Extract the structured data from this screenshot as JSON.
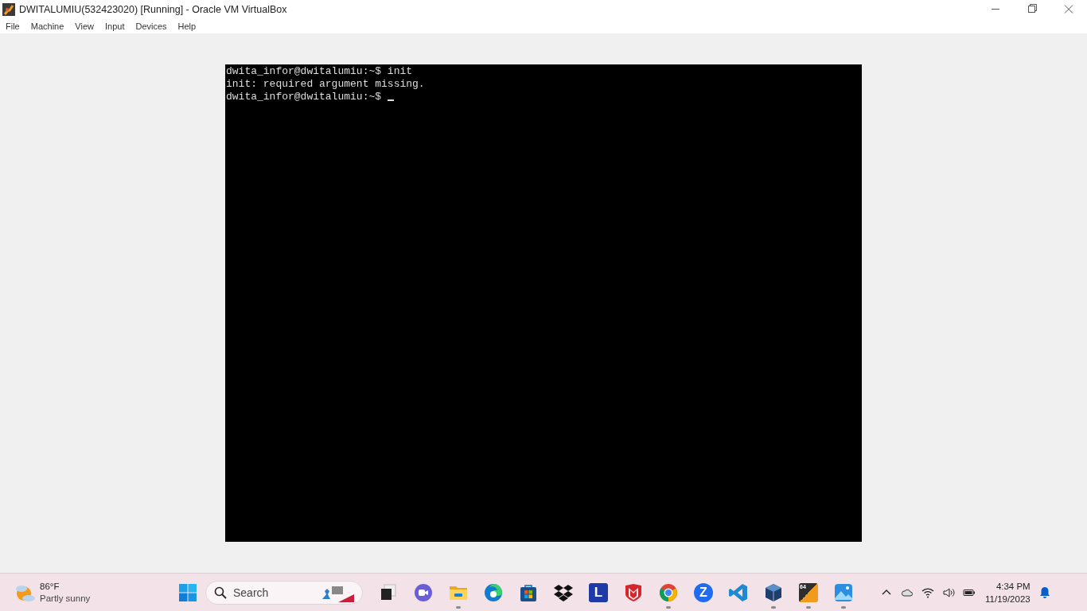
{
  "window": {
    "title": "DWITALUMIU(532423020) [Running] - Oracle VM VirtualBox"
  },
  "menu": [
    "File",
    "Machine",
    "View",
    "Input",
    "Devices",
    "Help"
  ],
  "terminal": {
    "lines": [
      "dwita_infor@dwitalumiu:~$ init",
      "init: required argument missing.",
      "dwita_infor@dwitalumiu:~$ "
    ],
    "cursor_visible": true
  },
  "taskbar": {
    "weather": {
      "temperature": "86°F",
      "condition": "Partly sunny"
    },
    "search": {
      "placeholder": "Search"
    },
    "apps": [
      {
        "kind": "windows-start",
        "running": false
      },
      {
        "kind": "task-view",
        "running": false
      },
      {
        "kind": "chat",
        "running": false
      },
      {
        "kind": "folder",
        "running": true
      },
      {
        "kind": "edge",
        "running": false
      },
      {
        "kind": "store",
        "running": false
      },
      {
        "kind": "dropbox",
        "running": false
      },
      {
        "kind": "letter",
        "glyph": "L",
        "running": false
      },
      {
        "kind": "shield",
        "running": false
      },
      {
        "kind": "chrome",
        "running": true
      },
      {
        "kind": "zoom",
        "glyph": "Z",
        "running": false
      },
      {
        "kind": "vscode",
        "running": false
      },
      {
        "kind": "cube",
        "running": true
      },
      {
        "kind": "app64",
        "glyph": "64",
        "running": true
      },
      {
        "kind": "photos",
        "running": true
      }
    ],
    "tray": [
      {
        "kind": "chevron"
      },
      {
        "kind": "cloud"
      },
      {
        "kind": "wifi"
      },
      {
        "kind": "volume"
      },
      {
        "kind": "battery"
      }
    ],
    "clock": {
      "time": "4:34 PM",
      "date": "11/19/2023"
    }
  }
}
